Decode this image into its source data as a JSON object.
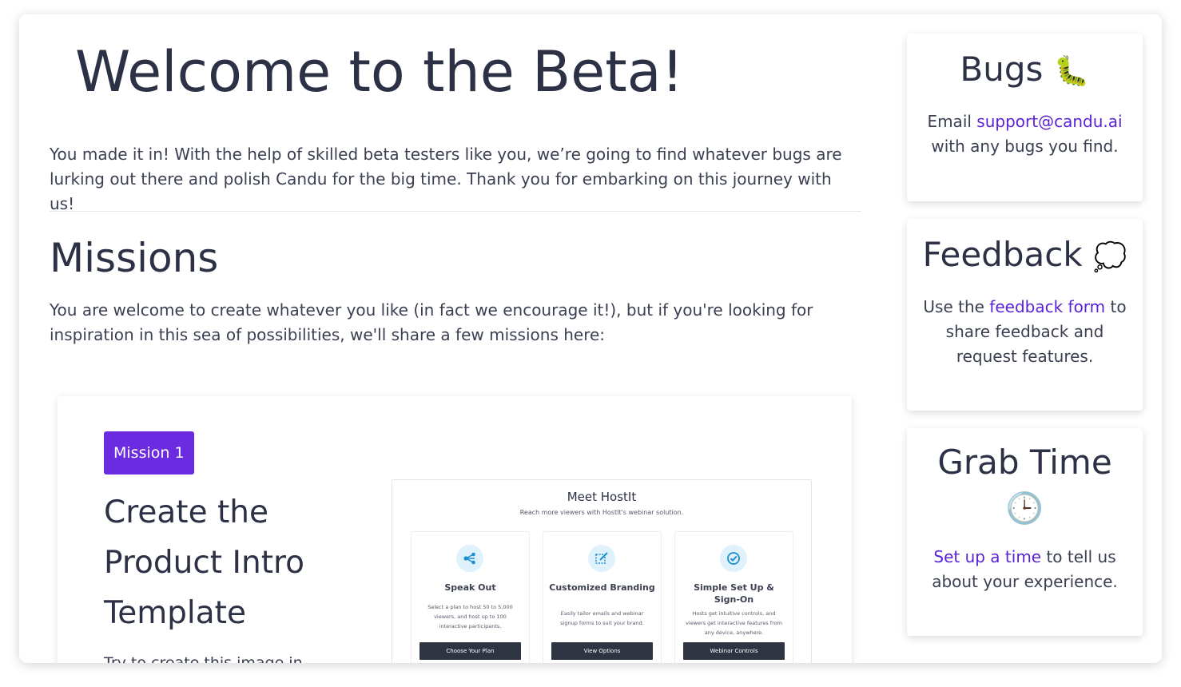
{
  "header": {
    "title": "Welcome to the Beta!",
    "intro": "You made it in! With the help of skilled beta testers like you, we’re going to find whatever bugs are lurking out there and polish Candu for the big time. Thank you for embarking on this journey with us!"
  },
  "missions": {
    "title": "Missions",
    "description": "You are welcome to create whatever you like (in fact we encourage it!), but if you're looking for inspiration in this sea of possibilities, we'll share a few missions here:",
    "items": [
      {
        "badge": "Mission 1",
        "title": "Create the Product Intro Template",
        "description": "Try to create this image in",
        "preview": {
          "title": "Meet HostIt",
          "subtitle": "Reach more viewers with HostIt's webinar solution.",
          "features": [
            {
              "icon": "share-nodes-icon",
              "title": "Speak Out",
              "text": "Select a plan to host 50 to 5,000 viewers, and host up to 100 interactive participants.",
              "button": "Choose Your Plan"
            },
            {
              "icon": "edit-icon",
              "title": "Customized Branding",
              "text": "Easily tailor emails and webinar signup forms to suit your brand.",
              "button": "View Options"
            },
            {
              "icon": "check-circle-icon",
              "title": "Simple Set Up & Sign-On",
              "text": "Hosts get intuitive controls, and viewers get interactive features from any device, anywhere.",
              "button": "Webinar Controls"
            }
          ]
        }
      }
    ]
  },
  "sidebar": {
    "bugs": {
      "title": "Bugs",
      "emoji": "🐛",
      "text_before": "Email ",
      "link": "support@candu.ai",
      "text_after": "with any bugs you find."
    },
    "feedback": {
      "title": "Feedback",
      "emoji": "💭",
      "text_before": "Use the ",
      "link": "feedback form",
      "text_after": " to share feedback and request features."
    },
    "grab_time": {
      "title": "Grab Time",
      "emoji": "🕒",
      "link": "Set up a time",
      "text_after": " to tell us about your experience."
    }
  },
  "colors": {
    "accent": "#6b2be0",
    "link": "#5a22d6",
    "text": "#2c3145",
    "button_dark": "#2f3443"
  }
}
